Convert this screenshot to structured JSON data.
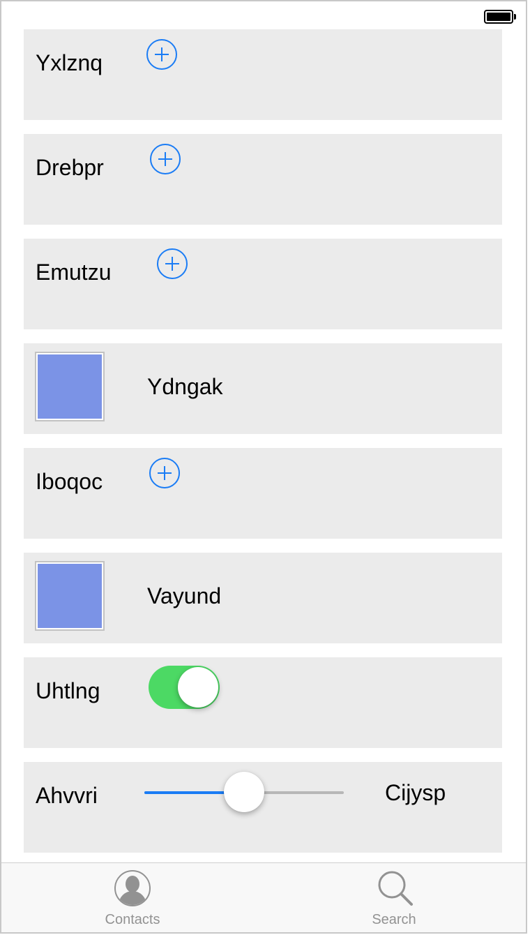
{
  "rows": {
    "yxlznq": {
      "label": "Yxlznq"
    },
    "drebpr": {
      "label": "Drebpr"
    },
    "emutzu": {
      "label": "Emutzu"
    },
    "ydngak": {
      "label": "Ydngak"
    },
    "iboqoc": {
      "label": "Iboqoc"
    },
    "vayund": {
      "label": "Vayund"
    },
    "uhtlng": {
      "label": "Uhtlng",
      "toggle_on": true
    },
    "ahvvri": {
      "label": "Ahvvri",
      "slider_value": 0.5,
      "max_label": "Cijysp"
    }
  },
  "colors": {
    "accent": "#1a7cf5",
    "toggle_on": "#4cd964",
    "image_swatch": "#7b93e6",
    "row_background": "#ebebeb"
  },
  "tab_bar": {
    "tabs": [
      {
        "label": "Contacts",
        "icon": "contacts-icon"
      },
      {
        "label": "Search",
        "icon": "search-icon"
      }
    ]
  }
}
